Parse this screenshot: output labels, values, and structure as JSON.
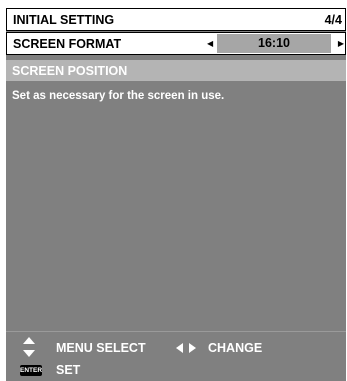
{
  "menu": {
    "title": "INITIAL SETTING",
    "page": "4/4",
    "screen_format": {
      "label": "SCREEN FORMAT",
      "value": "16:10"
    },
    "screen_position": {
      "label": "SCREEN POSITION"
    },
    "help_text": "Set as necessary for the screen in use."
  },
  "footer": {
    "menu_select": "MENU SELECT",
    "change": "CHANGE",
    "enter_key": "ENTER",
    "set": "SET"
  },
  "icons": {
    "updown": "up-down-arrows-icon",
    "leftright": "left-right-arrows-icon",
    "enter": "enter-key-icon"
  },
  "colors": {
    "panel_bg": "#808080",
    "highlight_bg": "#b4b4b4",
    "value_bg": "#a6a6a6"
  }
}
